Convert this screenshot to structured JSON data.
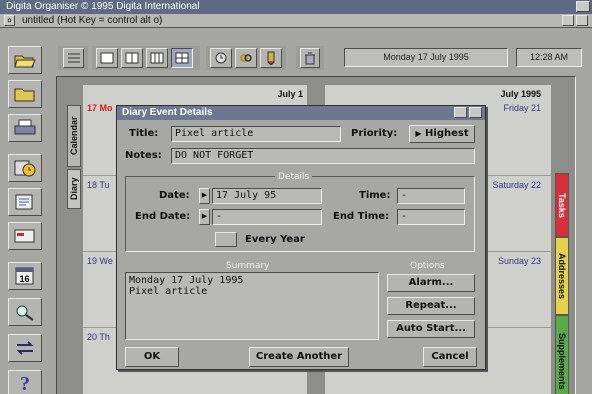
{
  "screen": {
    "title": "Digita Organiser © 1995 Digita International"
  },
  "window": {
    "close_glyph": "¤",
    "title": "untitled  (Hot Key = control alt o)"
  },
  "toolbar": {
    "date": "Monday 17 July 1995",
    "time": "12:28 AM"
  },
  "left_toolbar": {
    "icons": [
      "folder-open-icon",
      "folder-icon",
      "printer-icon",
      "clock-icon",
      "notepad-icon",
      "card-icon",
      "calendar-16-icon",
      "search-icon",
      "swap-arrows-icon",
      "help-icon"
    ],
    "calendar_day": "16",
    "help_glyph": "?"
  },
  "diary": {
    "left_tabs": [
      "Calendar",
      "Diary"
    ],
    "right_tabs": [
      "Tasks",
      "Addresses",
      "Supplements"
    ],
    "left_month": "July 1",
    "right_month": "July 1995",
    "left_days": [
      "17 Mo",
      "18 Tu",
      "19 We",
      "20 Th"
    ],
    "right_days": [
      "Friday 21",
      "Saturday 22",
      "Sunday 23"
    ],
    "colors": {
      "tasks": "#d8303a",
      "addresses": "#e6d24a",
      "supplements": "#5aaa4a",
      "today": "#d02020",
      "day_text": "#2d3a86"
    }
  },
  "dialog": {
    "title": "Diary Event Details",
    "title_label": "Title:",
    "title_value": "Pixel article",
    "priority_label": "Priority:",
    "priority_value": "Highest",
    "notes_label": "Notes:",
    "notes_value": "DO NOT FORGET",
    "details_group": "Details",
    "date_label": "Date:",
    "date_value": "17 July 95",
    "end_date_label": "End Date:",
    "end_date_value": "-",
    "time_label": "Time:",
    "time_value": "-",
    "end_time_label": "End Time:",
    "end_time_value": "-",
    "every_year_label": "Every Year",
    "summary_group": "Summary",
    "summary_line1": "Monday 17 July 1995",
    "summary_line2": "Pixel article",
    "options_group": "Options",
    "alarm_button": "Alarm...",
    "repeat_button": "Repeat...",
    "auto_start_button": "Auto Start...",
    "ok_button": "OK",
    "create_another_button": "Create Another",
    "cancel_button": "Cancel"
  }
}
